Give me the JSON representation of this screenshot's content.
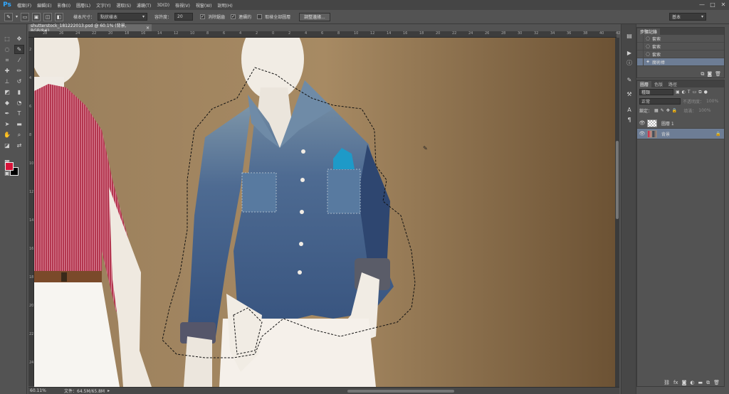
{
  "app": {
    "logo": "Ps"
  },
  "menubar": {
    "items": [
      "檔案(F)",
      "編輯(E)",
      "影像(I)",
      "圖層(L)",
      "文字(Y)",
      "選取(S)",
      "濾鏡(T)",
      "3D(D)",
      "檢視(V)",
      "視窗(W)",
      "說明(H)"
    ],
    "window_controls": [
      "—",
      "□",
      "✕"
    ]
  },
  "options_bar": {
    "tool_icon": "quick-selection-icon",
    "sample_size_label": "樣本尺寸：",
    "sample_size_value": "點狀樣本",
    "tolerance_label": "容許度：",
    "tolerance_value": "20",
    "antialias_label": "消除鋸齒",
    "contiguous_label": "連續的",
    "sample_all_layers_label": "取樣全部圖層",
    "refine_edge_button": "調整邊緣...",
    "workspace_value": "基本"
  },
  "document": {
    "tab_title": "shutterstock_181222013.psd @ 60.1% (背景, RGB/8#)",
    "tab_close": "×",
    "ruler_top_ticks": [
      "28",
      "26",
      "24",
      "22",
      "20",
      "18",
      "16",
      "14",
      "12",
      "10",
      "8",
      "6",
      "4",
      "2",
      "0",
      "2",
      "4",
      "6",
      "8",
      "10",
      "12",
      "14",
      "16",
      "18",
      "20",
      "22",
      "24",
      "26",
      "28",
      "30",
      "32",
      "34",
      "36",
      "38",
      "40",
      "42"
    ],
    "ruler_left_ticks": [
      "2",
      "4",
      "6",
      "8",
      "10",
      "12",
      "14",
      "16",
      "18",
      "20",
      "22",
      "24"
    ]
  },
  "status": {
    "zoom": "60.11%",
    "doc_info": "文件：64.5M/65.8M"
  },
  "history_panel": {
    "tabs": [
      "步驟記錄"
    ],
    "rows": [
      {
        "icon": "lasso-icon",
        "label": "套索"
      },
      {
        "icon": "lasso-icon",
        "label": "套索"
      },
      {
        "icon": "lasso-icon",
        "label": "套索"
      },
      {
        "icon": "magic-wand-icon",
        "label": "魔術棒"
      }
    ],
    "footer_icons": [
      "new-snapshot-icon",
      "camera-icon",
      "trash-icon"
    ]
  },
  "layers_panel": {
    "tabs": [
      "圖層",
      "色版",
      "路徑"
    ],
    "filter_kind": "種類",
    "blend_mode": "正常",
    "opacity_label": "不透明度：",
    "opacity_value": "100%",
    "lock_label": "鎖定：",
    "fill_label": "填滿：",
    "fill_value": "100%",
    "layers": [
      {
        "name": "圖層 1",
        "visible": true,
        "thumb": "transparent",
        "active": false
      },
      {
        "name": "背景",
        "visible": true,
        "thumb": "photo",
        "active": true,
        "locked": true
      }
    ],
    "footer_icons": [
      "link-icon",
      "fx-icon",
      "mask-icon",
      "adjustment-icon",
      "folder-icon",
      "new-layer-icon",
      "trash-icon"
    ]
  },
  "colors": {
    "foreground": "#d8143a",
    "background": "#000000",
    "selection": "#6d7d95"
  }
}
